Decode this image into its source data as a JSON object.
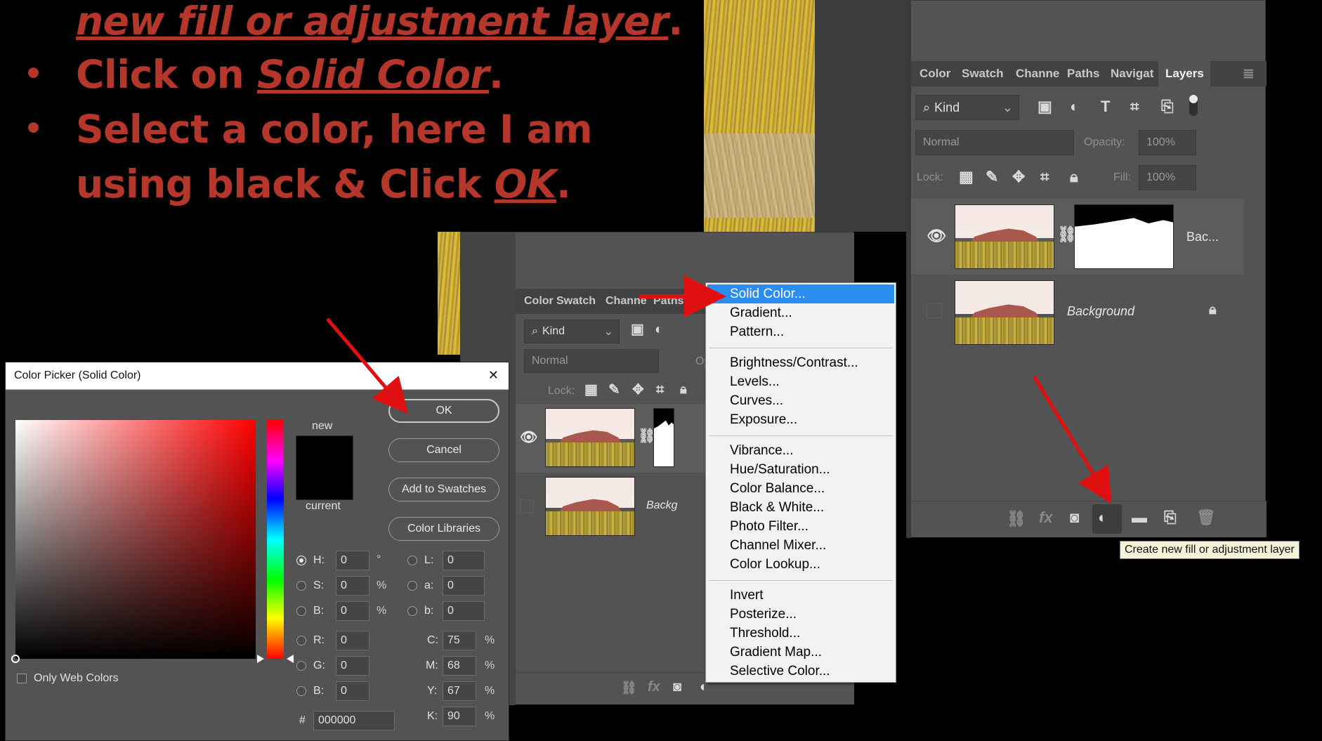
{
  "slide": {
    "line1": "new fill or adjustment layer",
    "line1_end": ".",
    "line2_pre": "Click on ",
    "line2_em": "Solid Color",
    "line2_end": ".",
    "line3": "Select a color, here I am",
    "line4_pre": "using black & Click ",
    "line4_em": "OK",
    "line4_end": ".",
    "bullet": "•"
  },
  "right_panel": {
    "tabs": [
      "Color",
      "Swatch",
      "Channe",
      "Paths",
      "Navigat",
      "Layers"
    ],
    "filter_kind": "Kind",
    "blend_mode": "Normal",
    "opacity_label": "Opacity:",
    "opacity_value": "100%",
    "lock_label": "Lock:",
    "fill_label": "Fill:",
    "fill_value": "100%",
    "layer1_name": "Bac...",
    "layer2_name": "Background",
    "tooltip": "Create new fill or adjustment layer"
  },
  "middle_panel": {
    "tabs": [
      "Color",
      "Swatch",
      "Channe",
      "Paths"
    ],
    "filter_kind": "Kind",
    "blend_mode": "Normal",
    "opacity_label": "Op",
    "lock_label": "Lock:",
    "layer2_name": "Backg"
  },
  "menu": {
    "group1": [
      "Solid Color...",
      "Gradient...",
      "Pattern..."
    ],
    "group2": [
      "Brightness/Contrast...",
      "Levels...",
      "Curves...",
      "Exposure..."
    ],
    "group3": [
      "Vibrance...",
      "Hue/Saturation...",
      "Color Balance...",
      "Black & White...",
      "Photo Filter...",
      "Channel Mixer...",
      "Color Lookup..."
    ],
    "group4": [
      "Invert",
      "Posterize...",
      "Threshold...",
      "Gradient Map...",
      "Selective Color..."
    ]
  },
  "color_picker": {
    "title": "Color Picker (Solid Color)",
    "close": "✕",
    "ok": "OK",
    "cancel": "Cancel",
    "add_to_swatches": "Add to Swatches",
    "color_libraries": "Color Libraries",
    "new_label": "new",
    "current_label": "current",
    "only_web_colors": "Only Web Colors",
    "H": "0",
    "S": "0",
    "B": "0",
    "R": "0",
    "G": "0",
    "B2": "0",
    "L": "0",
    "a": "0",
    "b": "0",
    "C": "75",
    "M": "68",
    "Y": "67",
    "K": "90",
    "hex": "000000",
    "labels": {
      "H": "H:",
      "S": "S:",
      "B": "B:",
      "R": "R:",
      "G": "G:",
      "B2": "B:",
      "L": "L:",
      "a": "a:",
      "b": "b:",
      "C": "C:",
      "M": "M:",
      "Y": "Y:",
      "K": "K:",
      "hash": "#"
    },
    "units": {
      "deg": "°",
      "pct": "%"
    },
    "selected_color": "#000000"
  },
  "colors": {
    "slide_text": "#b5372c",
    "menu_highlight": "#2c8df0",
    "arrow": "#e01010",
    "panel_bg": "#535353"
  }
}
